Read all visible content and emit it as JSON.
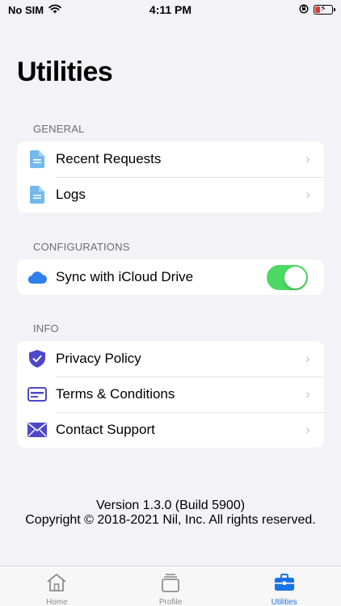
{
  "status": {
    "carrier": "No SIM",
    "time": "4:11 PM"
  },
  "page": {
    "title": "Utilities"
  },
  "sections": {
    "general": {
      "header": "GENERAL",
      "items": [
        {
          "label": "Recent Requests",
          "icon": "document-icon"
        },
        {
          "label": "Logs",
          "icon": "document-icon"
        }
      ]
    },
    "configurations": {
      "header": "CONFIGURATIONS",
      "items": [
        {
          "label": "Sync with iCloud Drive",
          "icon": "cloud-icon",
          "toggle_on": true
        }
      ]
    },
    "info": {
      "header": "INFO",
      "items": [
        {
          "label": "Privacy Policy",
          "icon": "shield-check-icon"
        },
        {
          "label": "Terms & Conditions",
          "icon": "card-icon"
        },
        {
          "label": "Contact Support",
          "icon": "envelope-icon"
        }
      ]
    }
  },
  "footer": {
    "version": "Version 1.3.0 (Build 5900)",
    "copyright": "Copyright © 2018-2021 Nil, Inc. All rights reserved."
  },
  "tabs": [
    {
      "label": "Home",
      "icon": "house-icon",
      "active": false
    },
    {
      "label": "Profile",
      "icon": "stack-icon",
      "active": false
    },
    {
      "label": "Utilities",
      "icon": "briefcase-icon",
      "active": true
    }
  ],
  "colors": {
    "accent": "#1a73e8",
    "toggle_on": "#4cd964",
    "doc_icon": "#74b9ea",
    "cloud_icon": "#2f80ed",
    "info_icon": "#4e47c9"
  }
}
